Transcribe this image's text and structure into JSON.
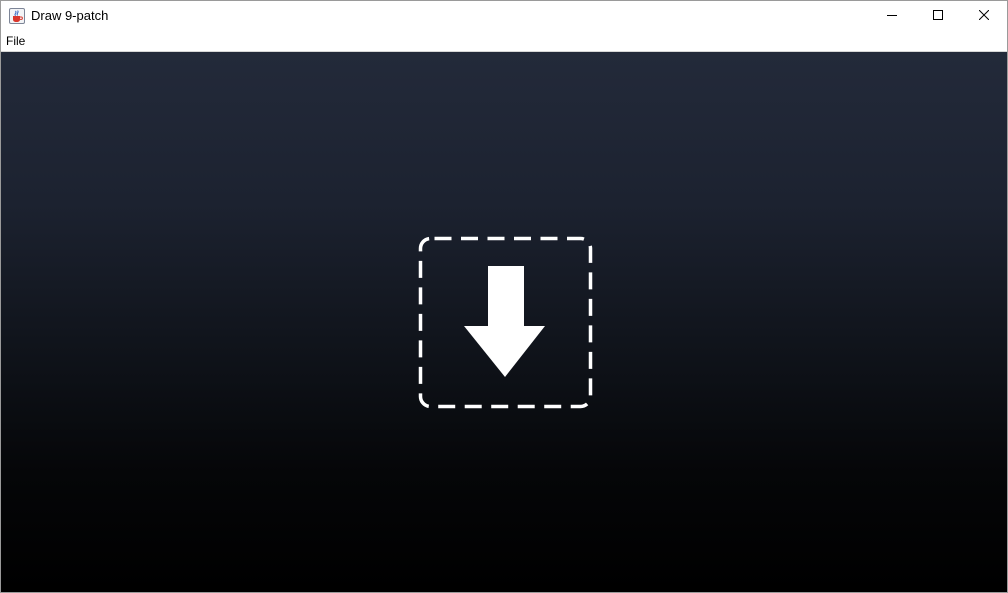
{
  "window": {
    "title": "Draw 9-patch"
  },
  "title_icons": {
    "app": "java-cup-icon",
    "minimize": "minimize-icon",
    "maximize": "maximize-icon",
    "close": "close-icon"
  },
  "menu": {
    "items": [
      {
        "label": "File"
      }
    ]
  },
  "canvas": {
    "drop_zone_icon": "download-arrow-icon",
    "gradient_top": "#232a3a",
    "gradient_bottom": "#000000",
    "icon_color": "#ffffff"
  }
}
